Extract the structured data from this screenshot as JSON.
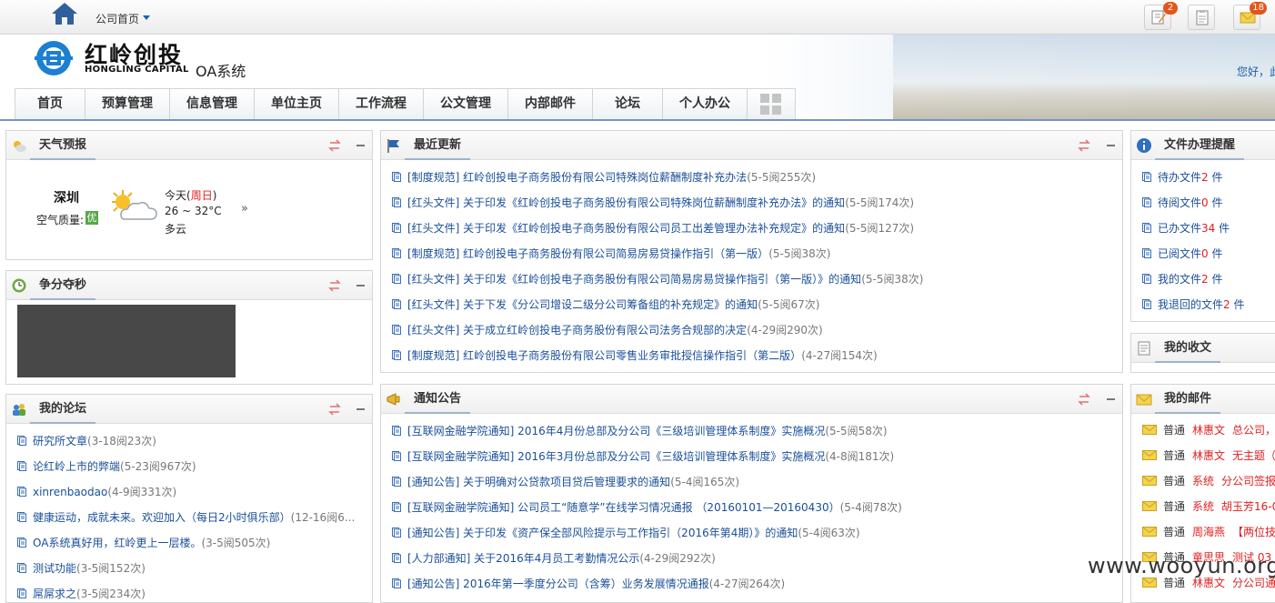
{
  "topbar": {
    "home_label": "公司首页",
    "buttons": [
      {
        "icon": "edit-note-icon",
        "badge": "2"
      },
      {
        "icon": "clipboard-icon",
        "badge": ""
      },
      {
        "icon": "message-envelope-icon",
        "badge": "18"
      }
    ]
  },
  "header": {
    "logo_cn": "红岭创投",
    "logo_en": "HONGLING CAPITAL",
    "system_label": "OA系统",
    "greeting": "您好，此"
  },
  "nav": {
    "items": [
      "首页",
      "预算管理",
      "信息管理",
      "单位主页",
      "工作流程",
      "公文管理",
      "内部邮件",
      "论坛",
      "个人办公"
    ]
  },
  "weather": {
    "title": "天气预报",
    "city": "深圳",
    "air_quality_label": "空气质量:",
    "air_quality_value": "优",
    "day_prefix": "今天(",
    "weekday": "周日",
    "day_suffix": ")",
    "temp": "26 ~ 32°C",
    "desc": "多云",
    "next": "»"
  },
  "seconds": {
    "title": "争分夺秒"
  },
  "forum": {
    "title": "我的论坛",
    "items": [
      {
        "title": "研究所文章",
        "meta": "(3-18阅23次)"
      },
      {
        "title": "论红岭上市的弊端",
        "meta": "(5-23阅967次)"
      },
      {
        "title": "xinrenbaodao",
        "meta": "(4-9阅331次)"
      },
      {
        "title": "健康运动，成就未来。欢迎加入（每日2小时俱乐部）",
        "meta": "(12-16阅6..."
      },
      {
        "title": "OA系统真好用，红岭更上一层楼。",
        "meta": "(3-5阅505次)"
      },
      {
        "title": "测试功能",
        "meta": "(3-5阅152次)"
      },
      {
        "title": "屌屌求之",
        "meta": "(3-5阅234次)"
      }
    ]
  },
  "recent": {
    "title": "最近更新",
    "items": [
      {
        "title": "[制度规范] 红岭创投电子商务股份有限公司特殊岗位薪酬制度补充办法",
        "meta": "(5-5阅255次)"
      },
      {
        "title": "[红头文件] 关于印发《红岭创投电子商务股份有限公司特殊岗位薪酬制度补充办法》的通知",
        "meta": "(5-5阅174次)"
      },
      {
        "title": "[红头文件] 关于印发《红岭创投电子商务股份有限公司员工出差管理办法补充规定》的通知",
        "meta": "(5-5阅127次)"
      },
      {
        "title": "[制度规范] 红岭创投电子商务股份有限公司简易房易贷操作指引（第一版）",
        "meta": "(5-5阅38次)"
      },
      {
        "title": "[红头文件] 关于印发《红岭创投电子商务股份有限公司简易房易贷操作指引（第一版）》的通知",
        "meta": "(5-5阅38次)"
      },
      {
        "title": "[红头文件] 关于下发《分公司增设二级分公司筹备组的补充规定》的通知",
        "meta": "(5-5阅67次)"
      },
      {
        "title": "[红头文件] 关于成立红岭创投电子商务股份有限公司法务合规部的决定",
        "meta": "(4-29阅290次)"
      },
      {
        "title": "[制度规范] 红岭创投电子商务股份有限公司零售业务审批授信操作指引（第二版）",
        "meta": "(4-27阅154次)"
      }
    ]
  },
  "notice": {
    "title": "通知公告",
    "items": [
      {
        "title": "[互联网金融学院通知] 2016年4月份总部及分公司《三级培训管理体系制度》实施概况",
        "meta": "(5-5阅58次)"
      },
      {
        "title": "[互联网金融学院通知] 2016年3月份总部及分公司《三级培训管理体系制度》实施概况",
        "meta": "(4-8阅181次)"
      },
      {
        "title": "[通知公告] 关于明确对公贷款项目贷后管理要求的通知",
        "meta": "(5-4阅165次)"
      },
      {
        "title": "[互联网金融学院通知] 公司员工“随意学”在线学习情况通报 （20160101—20160430）",
        "meta": "(5-4阅78次)"
      },
      {
        "title": "[通知公告] 关于印发《资产保全部风险提示与工作指引（2016年第4期）》的通知",
        "meta": "(5-4阅63次)"
      },
      {
        "title": "[人力部通知] 关于2016年4月员工考勤情况公示",
        "meta": "(4-29阅292次)"
      },
      {
        "title": "[通知公告] 2016年第一季度分公司（含筹）业务发展情况通报",
        "meta": "(4-27阅264次)"
      }
    ]
  },
  "docs": {
    "title": "文件办理提醒",
    "items": [
      {
        "label": "待办文件",
        "count": "2",
        "unit": " 件"
      },
      {
        "label": "待阅文件",
        "count": "0",
        "unit": " 件"
      },
      {
        "label": "已办文件",
        "count": "34",
        "unit": " 件"
      },
      {
        "label": "已阅文件",
        "count": "0",
        "unit": " 件"
      },
      {
        "label": "我的文件",
        "count": "2",
        "unit": " 件"
      },
      {
        "label": "我退回的文件",
        "count": "2",
        "unit": " 件"
      }
    ]
  },
  "receipts": {
    "title": "我的收文"
  },
  "mail": {
    "title": "我的邮件",
    "items": [
      {
        "tag": "普通",
        "from": "林惠文",
        "subject": "总公司，"
      },
      {
        "tag": "普通",
        "from": "林惠文",
        "subject": "无主题（"
      },
      {
        "tag": "普通",
        "from": "系统",
        "subject": "分公司签报"
      },
      {
        "tag": "普通",
        "from": "系统",
        "subject": "胡玉芳16-0"
      },
      {
        "tag": "普通",
        "from": "周海燕",
        "subject": "【两位技"
      },
      {
        "tag": "普通",
        "from": "童思思",
        "subject": "测试 03"
      },
      {
        "tag": "普通",
        "from": "林惠文",
        "subject": "分公司通"
      }
    ]
  },
  "watermark": "www.wooyun.org",
  "colors": {
    "link": "#1a4f99",
    "accent_red": "#e02020",
    "header_rule": "#6f98c2"
  }
}
